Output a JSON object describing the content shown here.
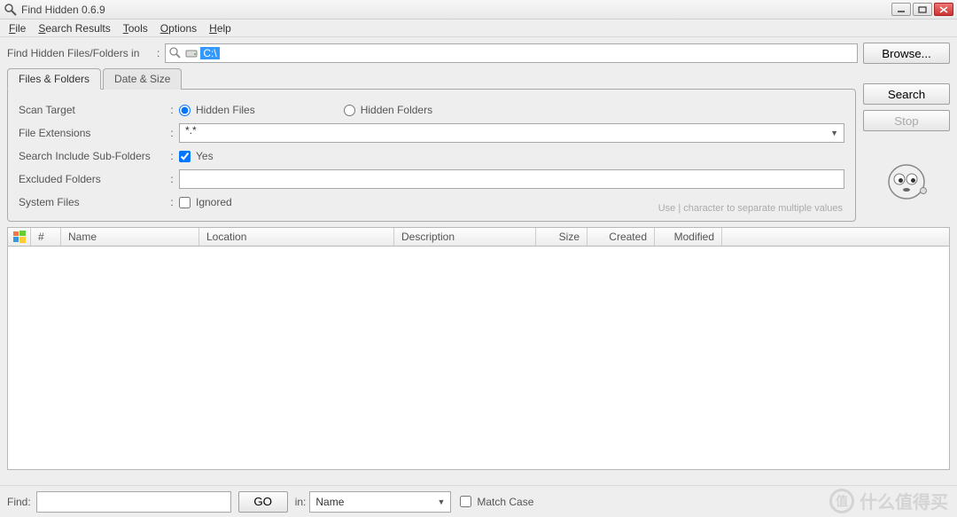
{
  "titlebar": {
    "title": "Find Hidden 0.6.9"
  },
  "menu": {
    "file": "File",
    "file_u": "F",
    "search_results": "Search Results",
    "search_results_u": "S",
    "tools": "Tools",
    "tools_u": "T",
    "options": "Options",
    "options_u": "O",
    "help": "Help",
    "help_u": "H"
  },
  "path_row": {
    "label": "Find Hidden Files/Folders in",
    "value": "C:\\",
    "browse": "Browse..."
  },
  "tabs": {
    "files_folders": "Files & Folders",
    "date_size": "Date & Size"
  },
  "form": {
    "scan_target": "Scan Target",
    "hidden_files": "Hidden Files",
    "hidden_folders": "Hidden Folders",
    "file_extensions": "File Extensions",
    "ext_value": "*.*",
    "include_sub": "Search Include Sub-Folders",
    "yes": "Yes",
    "excluded": "Excluded Folders",
    "excluded_value": "",
    "system_files": "System Files",
    "ignored": "Ignored",
    "hint": "Use | character to separate multiple values"
  },
  "side": {
    "search": "Search",
    "stop": "Stop"
  },
  "columns": {
    "num": "#",
    "name": "Name",
    "location": "Location",
    "description": "Description",
    "size": "Size",
    "created": "Created",
    "modified": "Modified"
  },
  "footer": {
    "find_label": "Find:",
    "go": "GO",
    "in_label": "in:",
    "in_value": "Name",
    "match_case": "Match Case"
  },
  "watermark": "什么值得买"
}
